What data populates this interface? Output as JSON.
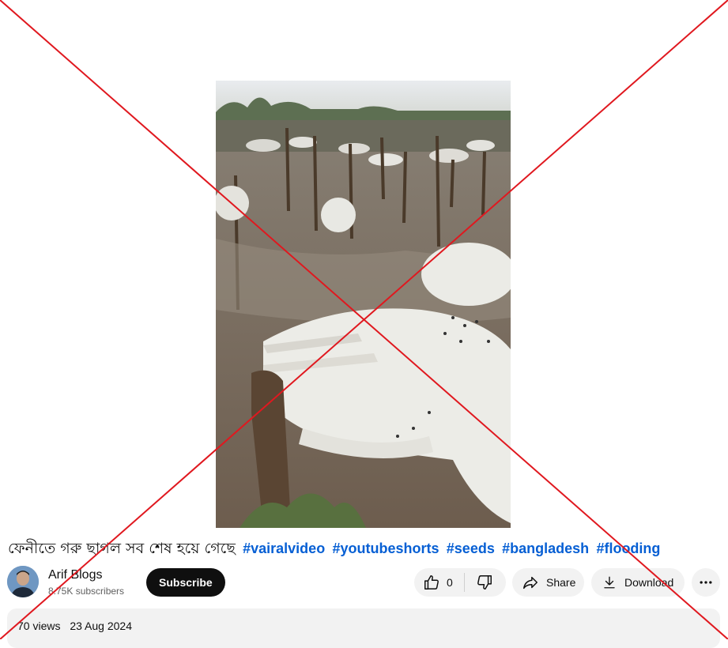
{
  "video": {
    "title_main": "ফেনীতে গরু ছাগল সব শেষ হয়ে গেছে",
    "hashtags": [
      "#vairalvideo",
      "#youtubeshorts",
      "#seeds",
      "#bangladesh",
      "#flooding"
    ]
  },
  "channel": {
    "name": "Arif Blogs",
    "subscribers": "8.75K subscribers"
  },
  "actions": {
    "subscribe_label": "Subscribe",
    "like_count": "0",
    "share_label": "Share",
    "download_label": "Download"
  },
  "description": {
    "views": "70 views",
    "date": "23 Aug 2024"
  },
  "icons": {
    "like": "thumbs-up-icon",
    "dislike": "thumbs-down-icon",
    "share": "share-arrow-icon",
    "download": "download-icon",
    "more": "more-horizontal-icon"
  },
  "colors": {
    "hashtag": "#065fd4",
    "cross_overlay": "#e0181f",
    "subscribe_bg": "#0f0f0f"
  }
}
